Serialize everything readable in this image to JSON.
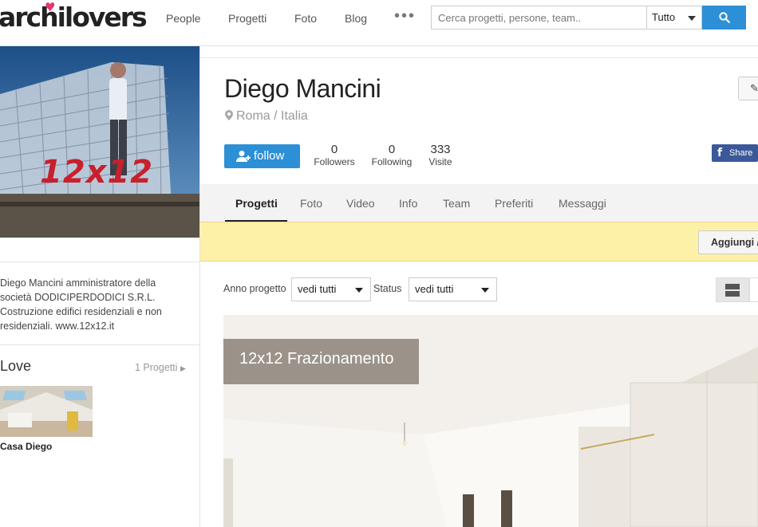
{
  "header": {
    "logo_text": "archilovers",
    "nav": [
      "People",
      "Progetti",
      "Foto",
      "Blog"
    ],
    "more_label": "•••",
    "search": {
      "placeholder": "Cerca progetti, persone, team..",
      "value": ""
    },
    "search_scope": "Tutto",
    "search_icon": "search-icon"
  },
  "sidebar": {
    "cover_text": "12x12",
    "bio": "Diego Mancini amministratore della società DODICIPERDODICI S.R.L. Costruzione edifici residenziali e non residenziali. www.12x12.it",
    "love_title": "Love",
    "love_link": "1 Progetti",
    "love_item_caption": "Casa Diego"
  },
  "profile": {
    "name": "Diego Mancini",
    "location": "Roma / Italia",
    "follow_label": "follow",
    "stats": [
      {
        "value": "0",
        "label": "Followers"
      },
      {
        "value": "0",
        "label": "Following"
      },
      {
        "value": "333",
        "label": "Visite"
      }
    ],
    "share_label": "Share"
  },
  "tabs": [
    "Progetti",
    "Foto",
    "Video",
    "Info",
    "Team",
    "Preferiti",
    "Messaggi"
  ],
  "active_tab": "Progetti",
  "notice": {
    "add_button_label": "Aggiungi /"
  },
  "filters": {
    "year_label": "Anno progetto",
    "year_value": "vedi tutti",
    "status_label": "Status",
    "status_value": "vedi tutti"
  },
  "project": {
    "title": "12x12 Frazionamento"
  },
  "colors": {
    "accent": "#2d8fd5",
    "facebook": "#3b5998",
    "notice_bg": "#fdf1a8",
    "love_heart": "#e8336f"
  }
}
